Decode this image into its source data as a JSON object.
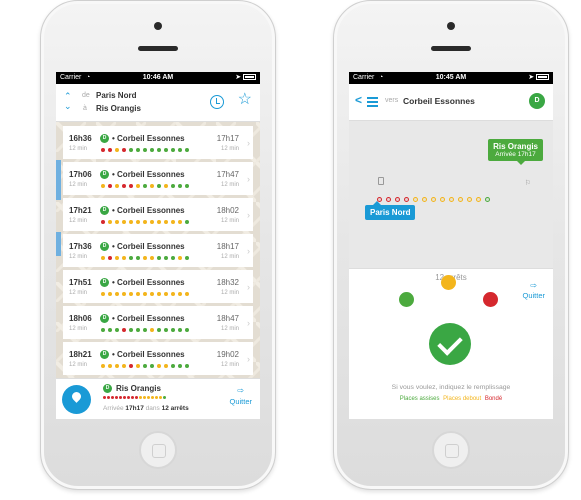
{
  "colors": {
    "green": "#4caa3e",
    "yellow": "#f3b51c",
    "red": "#d5282e",
    "blue": "#1a9ad6"
  },
  "screen1": {
    "status": {
      "carrier": "Carrier",
      "wifi_icon": "wifi-icon",
      "time": "10:46 AM"
    },
    "header": {
      "from_label": "de",
      "from": "Paris Nord",
      "to_label": "à",
      "to": "Ris Orangis",
      "clock_icon": "clock-icon",
      "star_icon": "star-icon"
    },
    "trips": [
      {
        "dep": "16h36",
        "dur": "12 min",
        "line": "D",
        "dest": "Corbeil Essonnes",
        "arr": "17h17",
        "dur2": "12 min",
        "dots": [
          "red",
          "red",
          "yellow",
          "red",
          "green",
          "green",
          "green",
          "green",
          "green",
          "green",
          "green",
          "green",
          "green"
        ]
      },
      {
        "dep": "17h06",
        "dur": "12 min",
        "line": "D",
        "dest": "Corbeil Essonnes",
        "arr": "17h47",
        "dur2": "12 min",
        "dots": [
          "yellow",
          "red",
          "yellow",
          "red",
          "red",
          "yellow",
          "green",
          "yellow",
          "green",
          "yellow",
          "green",
          "green",
          "green"
        ]
      },
      {
        "dep": "17h21",
        "dur": "12 min",
        "line": "D",
        "dest": "Corbeil Essonnes",
        "arr": "18h02",
        "dur2": "12 min",
        "dots": [
          "red",
          "yellow",
          "yellow",
          "yellow",
          "yellow",
          "yellow",
          "yellow",
          "yellow",
          "yellow",
          "yellow",
          "yellow",
          "yellow",
          "green"
        ]
      },
      {
        "dep": "17h36",
        "dur": "12 min",
        "line": "D",
        "dest": "Corbeil Essonnes",
        "arr": "18h17",
        "dur2": "12 min",
        "dots": [
          "yellow",
          "red",
          "yellow",
          "yellow",
          "green",
          "green",
          "yellow",
          "yellow",
          "green",
          "green",
          "green",
          "yellow",
          "green"
        ]
      },
      {
        "dep": "17h51",
        "dur": "12 min",
        "line": "D",
        "dest": "Corbeil Essonnes",
        "arr": "18h32",
        "dur2": "12 min",
        "dots": [
          "yellow",
          "yellow",
          "yellow",
          "yellow",
          "yellow",
          "yellow",
          "yellow",
          "yellow",
          "yellow",
          "yellow",
          "yellow",
          "yellow",
          "yellow"
        ]
      },
      {
        "dep": "18h06",
        "dur": "12 min",
        "line": "D",
        "dest": "Corbeil Essonnes",
        "arr": "18h47",
        "dur2": "12 min",
        "dots": [
          "green",
          "green",
          "green",
          "red",
          "green",
          "green",
          "green",
          "yellow",
          "green",
          "green",
          "green",
          "green",
          "green"
        ]
      },
      {
        "dep": "18h21",
        "dur": "12 min",
        "line": "D",
        "dest": "Corbeil Essonnes",
        "arr": "19h02",
        "dur2": "12 min",
        "dots": [
          "yellow",
          "yellow",
          "yellow",
          "yellow",
          "red",
          "yellow",
          "green",
          "green",
          "yellow",
          "yellow",
          "green",
          "green",
          "green"
        ]
      }
    ],
    "bottom": {
      "line": "D",
      "dest": "Ris Orangis",
      "arrival_label": "Arrivée",
      "arrival_time": "17h17",
      "in_label": "dans",
      "stops": "12 arrêts",
      "quit": "Quitter",
      "dots": [
        "red",
        "red",
        "red",
        "red",
        "red",
        "red",
        "red",
        "red",
        "red",
        "yellow",
        "yellow",
        "yellow",
        "yellow",
        "yellow",
        "yellow",
        "green"
      ]
    }
  },
  "screen2": {
    "status": {
      "carrier": "Carrier",
      "wifi_icon": "wifi-icon",
      "time": "10:45 AM"
    },
    "header": {
      "to_label": "vers",
      "dest": "Corbeil Essonnes",
      "line": "D"
    },
    "route": {
      "dest": "Ris Orangis",
      "arrival": "Arrivée 17h17",
      "origin": "Paris Nord",
      "stops": [
        "red",
        "red",
        "red",
        "red",
        "yellow",
        "yellow",
        "yellow",
        "yellow",
        "yellow",
        "yellow",
        "yellow",
        "yellow",
        "green"
      ]
    },
    "stop_count": "12 arrêts",
    "quit": "Quitter",
    "hint": "Si vous voulez, indiquez le remplissage",
    "legend": {
      "seated": "Places assises",
      "standing": "Places debout",
      "full": "Bondé"
    }
  }
}
